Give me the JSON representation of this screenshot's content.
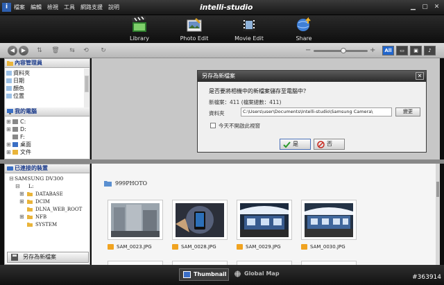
{
  "titlebar": {
    "menu": [
      "檔案",
      "編輯",
      "檢視",
      "工具",
      "網路支援",
      "說明"
    ],
    "app_title": "intelli-studio"
  },
  "modes": [
    {
      "label": "Library",
      "icon": "film-clapper-icon",
      "active": true
    },
    {
      "label": "Photo Edit",
      "icon": "photo-edit-icon"
    },
    {
      "label": "Movie Edit",
      "icon": "movie-edit-icon"
    },
    {
      "label": "Share",
      "icon": "share-globe-icon"
    }
  ],
  "navbar": {
    "zoom_minus": "−",
    "zoom_plus": "+",
    "zoom_level": 0.55,
    "filters": [
      {
        "label": "All",
        "active": true
      },
      {
        "label": "▭",
        "icon": "video-filter-icon"
      },
      {
        "label": "▣",
        "icon": "photo-filter-icon"
      },
      {
        "label": "♪",
        "icon": "audio-filter-icon"
      }
    ]
  },
  "content_manager": {
    "title": "內容管理員",
    "items": [
      "資料夾",
      "日期",
      "顏色",
      "位置"
    ]
  },
  "my_computer": {
    "title": "我的電腦",
    "items": [
      "C:",
      "D:",
      "F:",
      "桌面",
      "文件"
    ]
  },
  "devices": {
    "title": "已連接的裝置",
    "device": "SAMSUNG DV300",
    "drive": "L:",
    "folders": [
      "DATABASE",
      "DCIM",
      "DLNA_WEB_ROOT",
      "NFB",
      "SYSTEM"
    ]
  },
  "save_button": "另存為新檔案",
  "dialog": {
    "title": "另存為新檔案",
    "question": "是否要將相機中的新檔案儲存至電腦中？",
    "count": "新檔案：411 (檔案總數：411)",
    "folder_label": "資料夾",
    "path": "C:\\Users\\user\\Documents\\Intelli-studio\\Samsung Camera\\",
    "change": "變更",
    "checkbox_label": "今天不開啟此視窗",
    "yes": "是",
    "no": "否"
  },
  "gallery": {
    "folder": "999PHOTO",
    "items": [
      "SAM_0023.JPG",
      "SAM_0028.JPG",
      "SAM_0029.JPG",
      "SAM_0030.JPG"
    ]
  },
  "bottom_tabs": {
    "thumbnail": "Thumbnail",
    "globalmap": "Global Map"
  },
  "watermark": "#363914",
  "colors": {
    "accent": "#2266cc",
    "dialog_title": "#2b2b2b",
    "arrow": "#2f8be0"
  }
}
